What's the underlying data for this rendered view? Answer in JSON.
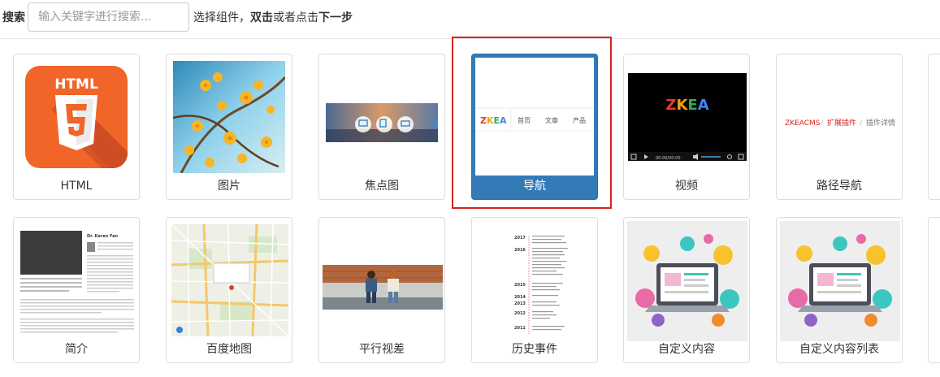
{
  "search": {
    "label": "搜索",
    "placeholder": "输入关键字进行搜索...",
    "value": ""
  },
  "hint": {
    "prefix": "选择组件，",
    "bold1": "双击",
    "mid": "或者点击",
    "bold2": "下一步"
  },
  "colors": {
    "selected": "#337ab7",
    "highlight_border": "#d9241f",
    "html_orange": "#f16529"
  },
  "components": [
    {
      "label": "HTML",
      "icon": "html5-logo"
    },
    {
      "label": "图片",
      "icon": "flower-photo"
    },
    {
      "label": "焦点图",
      "icon": "carousel-banner"
    },
    {
      "label": "导航",
      "icon": "navigation-bar",
      "selected": true,
      "thumb": {
        "logo": "ZKEA",
        "menu": [
          "首页",
          "文章",
          "产品"
        ]
      }
    },
    {
      "label": "视频",
      "icon": "video-player",
      "thumb": {
        "logo": "ZKEA",
        "time": "00:00/00:00"
      }
    },
    {
      "label": "路径导航",
      "icon": "breadcrumb",
      "thumb": {
        "crumbs": [
          "ZKEACMS",
          "扩展插件",
          "插件详情"
        ]
      }
    },
    {
      "label": "简介",
      "icon": "profile-summary",
      "thumb": {
        "name": "Dr. Karen Fan"
      }
    },
    {
      "label": "百度地图",
      "icon": "baidu-map"
    },
    {
      "label": "平行视差",
      "icon": "parallax-photo"
    },
    {
      "label": "历史事件",
      "icon": "timeline",
      "thumb": {
        "years": [
          "2017",
          "2016",
          "2015",
          "2014",
          "2013",
          "2012",
          "2011"
        ]
      }
    },
    {
      "label": "自定义内容",
      "icon": "custom-content-illustration"
    },
    {
      "label": "自定义内容列表",
      "icon": "custom-content-list-illustration"
    }
  ]
}
